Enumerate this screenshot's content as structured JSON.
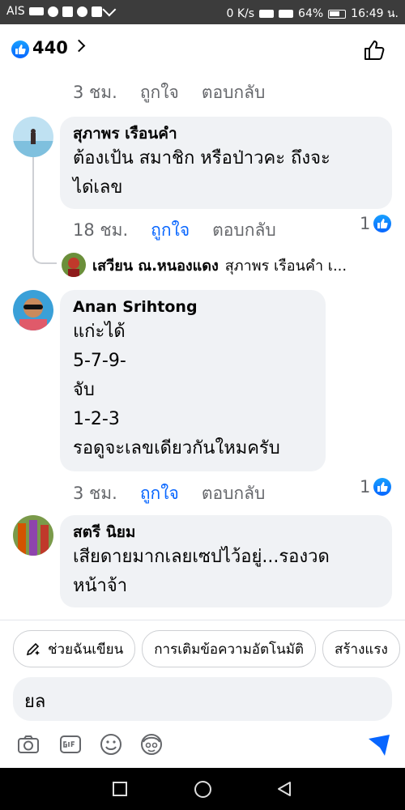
{
  "status_bar": {
    "carrier": "AIS",
    "speed": "0 K/s",
    "battery": "64%",
    "time": "16:49 น."
  },
  "header": {
    "like_count": "440"
  },
  "top_meta": {
    "time": "3 ชม.",
    "like": "ถูกใจ",
    "reply": "ตอบกลับ"
  },
  "comments": [
    {
      "author": "สุภาพร เรือนคำ",
      "lines": [
        "ต้องเป้น สมาชิก หรือป่าวคะ ถึงจะ",
        "ได่เลข"
      ],
      "time": "18 ชม.",
      "like": "ถูกใจ",
      "reply": "ตอบกลับ",
      "reactions": "1"
    },
    {
      "author": "Anan Srihtong",
      "lines": [
        "แก่ะได้",
        "5-7-9-",
        "จับ",
        "1-2-3",
        "รอดูจะเลขเดียวกันใหมครับ"
      ],
      "time": "3 ชม.",
      "like": "ถูกใจ",
      "reply": "ตอบกลับ",
      "reactions": "1"
    },
    {
      "author": "สตรี นิยม",
      "lines": [
        "เสียดายมากเลยเซปไว้อยู่...รองวด",
        "หน้าจ้า"
      ]
    }
  ],
  "reply_preview": {
    "author": "เสวียน ณ.หนองแดง",
    "text": "สุภาพร เรือนคำ เ..."
  },
  "chips": [
    "ช่วยฉันเขียน",
    "การเติมข้อความอัตโนมัติ",
    "สร้างแรง"
  ],
  "composer": {
    "value": "ยล"
  },
  "colors": {
    "accent": "#0866ff",
    "bubble": "#f0f2f5",
    "meta": "#65676b"
  }
}
